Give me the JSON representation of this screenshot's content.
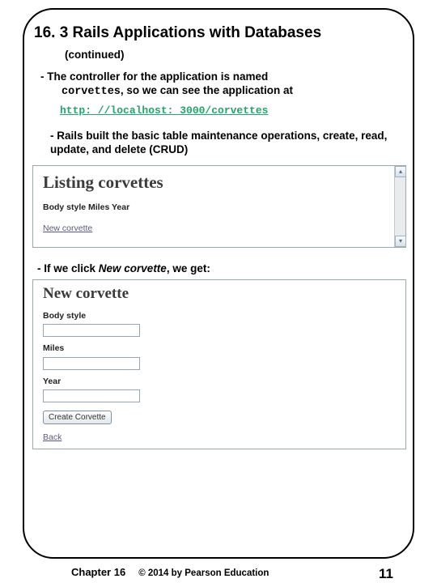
{
  "title": "16. 3 Rails Applications with Databases",
  "subtitle": "(continued)",
  "p1_a": "- The controller for the application is named",
  "p1_code": "corvettes",
  "p1_b": ", so we can see the application at",
  "link": "http: //localhost: 3000/corvettes",
  "p2": "- Rails built the basic table maintenance operations, create, read, update, and delete (CRUD)",
  "listing": {
    "heading": "Listing corvettes",
    "cols": "Body style Miles Year",
    "newlink": "New corvette"
  },
  "p3_a": "- If we click ",
  "p3_i": "New corvette",
  "p3_b": ", we get:",
  "form": {
    "heading": "New corvette",
    "f1": "Body style",
    "f2": "Miles",
    "f3": "Year",
    "btn": "Create Corvette",
    "back": "Back"
  },
  "footer": {
    "chapter": "Chapter 16",
    "copyright": "© 2014 by Pearson Education",
    "page": "11"
  }
}
